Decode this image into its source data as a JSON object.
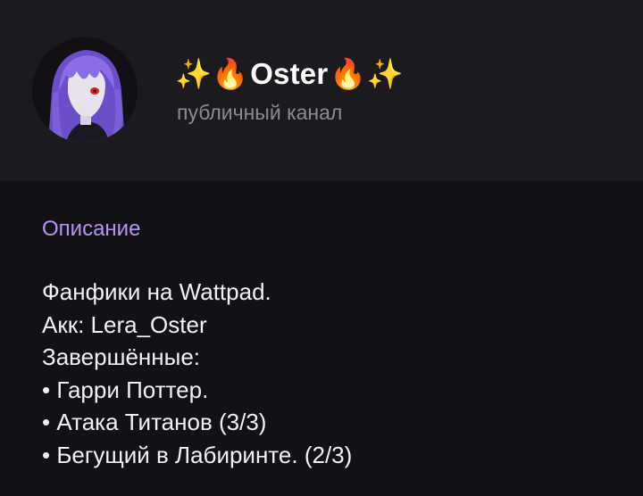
{
  "channel": {
    "title_prefix": "✨🔥",
    "name": "Oster",
    "title_suffix": "🔥✨",
    "type_label": "публичный канал",
    "avatar_description_icon": "anime-avatar"
  },
  "about": {
    "section_title": "Описание",
    "lines": [
      "Фанфики на Wattpad.",
      "Акк: Lera_Oster",
      "Завершённые:",
      "• Гарри Поттер.",
      "• Атака Титанов (3/3)",
      "• Бегущий в Лабиринте. (2/3)"
    ]
  },
  "colors": {
    "header_bg": "#1b1a1f",
    "body_bg": "#121116",
    "accent": "#b694f2",
    "muted": "#8d8a93",
    "text": "#f2f1f4"
  }
}
